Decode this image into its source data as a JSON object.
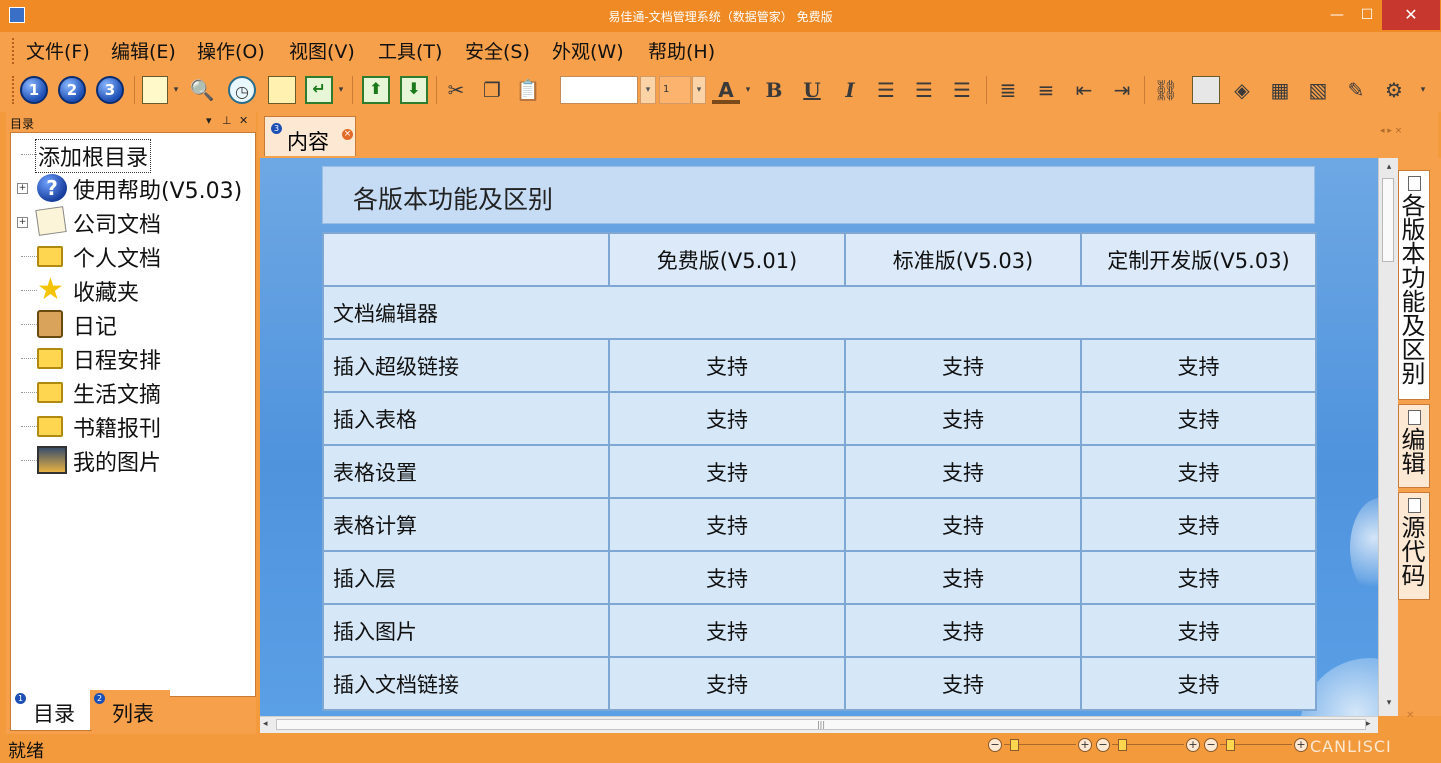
{
  "window": {
    "title": "易佳通-文档管理系统（数据管家） 免费版",
    "controls": [
      "—",
      "☐",
      "✕"
    ]
  },
  "menu": [
    "文件(F)",
    "编辑(E)",
    "操作(O)",
    "视图(V)",
    "工具(T)",
    "安全(S)",
    "外观(W)",
    "帮助(H)"
  ],
  "toolbar": {
    "level_buttons": [
      "1",
      "2",
      "3"
    ],
    "font_size": "1",
    "format_buttons": [
      "B",
      "U",
      "I"
    ]
  },
  "left_panel": {
    "title": "目录",
    "header_buttons": [
      "▾",
      "⊥",
      "✕"
    ],
    "tree": [
      {
        "label": "添加根目录",
        "icon": "none-icon"
      },
      {
        "label": "使用帮助(V5.03)",
        "icon": "help-icon",
        "expandable": true
      },
      {
        "label": "公司文档",
        "icon": "note-icon",
        "expandable": true
      },
      {
        "label": "个人文档",
        "icon": "folder-icon"
      },
      {
        "label": "收藏夹",
        "icon": "star-icon"
      },
      {
        "label": "日记",
        "icon": "clipboard-icon"
      },
      {
        "label": "日程安排",
        "icon": "folder-icon"
      },
      {
        "label": "生活文摘",
        "icon": "folder-icon"
      },
      {
        "label": "书籍报刊",
        "icon": "folder-icon"
      },
      {
        "label": "我的图片",
        "icon": "picture-icon"
      }
    ],
    "bottom_tabs": [
      {
        "num": "1",
        "label": "目录"
      },
      {
        "num": "2",
        "label": "列表"
      }
    ]
  },
  "document": {
    "tab": {
      "num": "3",
      "label": "内容"
    },
    "heading": "各版本功能及区别",
    "columns": [
      "",
      "免费版(V5.01)",
      "标准版(V5.03)",
      "定制开发版(V5.03)"
    ],
    "section_label": "文档编辑器",
    "rows": [
      {
        "feature": "插入超级链接",
        "values": [
          "支持",
          "支持",
          "支持"
        ]
      },
      {
        "feature": "插入表格",
        "values": [
          "支持",
          "支持",
          "支持"
        ]
      },
      {
        "feature": "表格设置",
        "values": [
          "支持",
          "支持",
          "支持"
        ]
      },
      {
        "feature": "表格计算",
        "values": [
          "支持",
          "支持",
          "支持"
        ]
      },
      {
        "feature": "插入层",
        "values": [
          "支持",
          "支持",
          "支持"
        ]
      },
      {
        "feature": "插入图片",
        "values": [
          "支持",
          "支持",
          "支持"
        ]
      },
      {
        "feature": "插入文档链接",
        "values": [
          "支持",
          "支持",
          "支持"
        ]
      }
    ]
  },
  "side_tabs": [
    "各版本功能及区别",
    "编辑",
    "源代码"
  ],
  "status": {
    "text": "就绪",
    "brand": "CANLISCI"
  }
}
